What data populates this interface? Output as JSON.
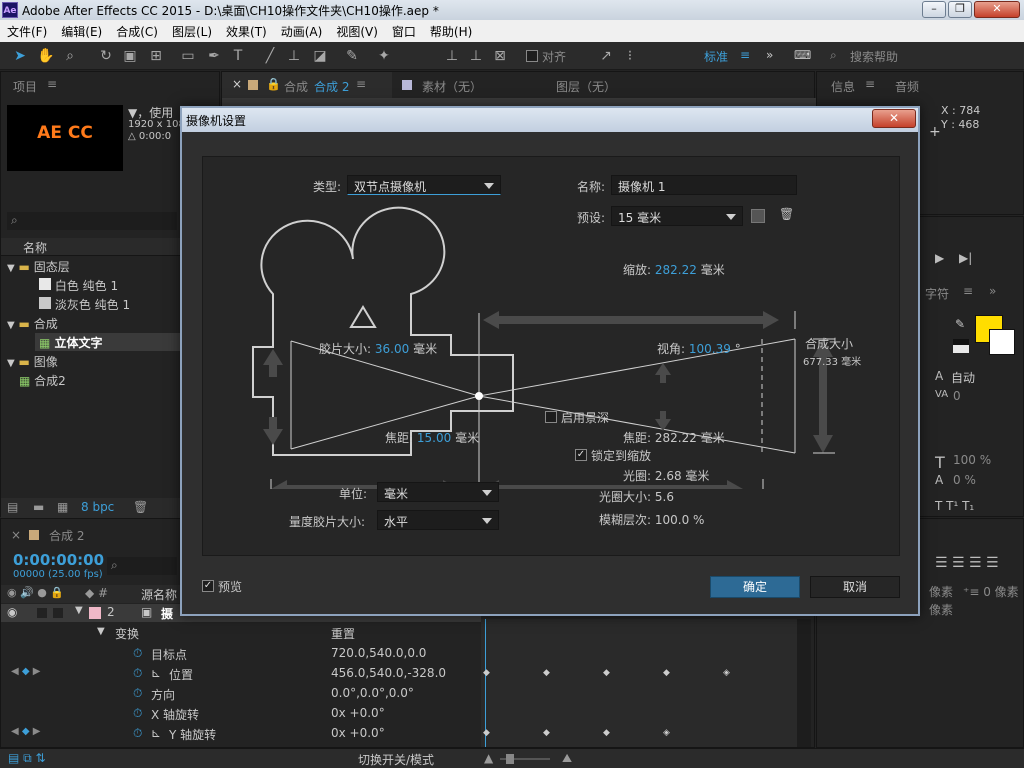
{
  "window": {
    "title": "Adobe After Effects CC 2015 - D:\\桌面\\CH10操作文件夹\\CH10操作.aep *",
    "minimize": "–",
    "restore": "❐",
    "close": "✕"
  },
  "menu": [
    "文件(F)",
    "编辑(E)",
    "合成(C)",
    "图层(L)",
    "效果(T)",
    "动画(A)",
    "视图(V)",
    "窗口",
    "帮助(H)"
  ],
  "toolbar": {
    "snap_label": "对齐",
    "workspace": "标准",
    "search_placeholder": "搜索帮助"
  },
  "project": {
    "tab": "项目",
    "thumb_text": "AE CC",
    "info_line1": "▼，使用",
    "info_line2": "1920 x 108",
    "info_line3": "△ 0:00:0",
    "col_name": "名称",
    "items": [
      {
        "label": "固态层",
        "type": "folder"
      },
      {
        "label": "白色 纯色 1",
        "type": "solid"
      },
      {
        "label": "淡灰色 纯色 1",
        "type": "solid"
      },
      {
        "label": "合成",
        "type": "folder"
      },
      {
        "label": "立体文字",
        "type": "comp"
      },
      {
        "label": "图像",
        "type": "folder"
      },
      {
        "label": "合成2",
        "type": "comp"
      }
    ],
    "bpc": "8 bpc"
  },
  "viewer": {
    "tab_comp": "合成",
    "tab_comp_name": "合成 2",
    "tab_footage": "素材（无）",
    "tab_layer": "图层（无）"
  },
  "info": {
    "tab_info": "信息",
    "tab_audio": "音频",
    "x": "X : 784",
    "y": "Y : 468"
  },
  "character": {
    "tab": "字符",
    "leading": "自动",
    "tracking": "0",
    "scale_v": "100 %",
    "scale_h": "0 %",
    "para_px1": "像素",
    "para_px2": "0 像素",
    "para_px3": "像素"
  },
  "timeline": {
    "tab": "合成 2",
    "timecode": "0:00:00:00",
    "frames": "00000 (25.00 fps)",
    "col_source": "源名称",
    "layer_num": "2",
    "layer_name": "摄",
    "transform": "变换",
    "reset": "重置",
    "props": [
      {
        "name": "目标点",
        "value": "720.0,540.0,0.0"
      },
      {
        "name": "位置",
        "value": "456.0,540.0,-328.0"
      },
      {
        "name": "方向",
        "value": "0.0°,0.0°,0.0°"
      },
      {
        "name": "X 轴旋转",
        "value": "0x +0.0°"
      },
      {
        "name": "Y 轴旋转",
        "value": "0x +0.0°"
      }
    ],
    "toggle_label": "切换开关/模式"
  },
  "dialog": {
    "title": "摄像机设置",
    "close": "✕",
    "type_label": "类型:",
    "type_value": "双节点摄像机",
    "name_label": "名称:",
    "name_value": "摄像机 1",
    "preset_label": "预设:",
    "preset_value": "15 毫米",
    "zoom_label": "缩放:",
    "zoom_value": "282.22",
    "zoom_unit": "毫米",
    "film_label": "胶片大小:",
    "film_value": "36.00",
    "film_unit": "毫米",
    "angle_label": "视角:",
    "angle_value": "100.39",
    "angle_unit": "°",
    "comp_size_label": "合成大小",
    "comp_size_value": "677.33 毫米",
    "focal_label": "焦距:",
    "focal_value": "15.00",
    "focal_unit": "毫米",
    "focus_dist_label": "焦距:",
    "focus_dist_value": "282.22",
    "focus_dist_unit": "毫米",
    "dof_label": "启用景深",
    "lock_label": "锁定到缩放",
    "aperture_label": "光圈:",
    "aperture_value": "2.68 毫米",
    "fstop_label": "光圈大小:",
    "fstop_value": "5.6",
    "blur_label": "模糊层次:",
    "blur_value": "100.0 %",
    "units_label": "单位:",
    "units_value": "毫米",
    "measure_label": "量度胶片大小:",
    "measure_value": "水平",
    "preview_label": "预览",
    "ok": "确定",
    "cancel": "取消"
  }
}
